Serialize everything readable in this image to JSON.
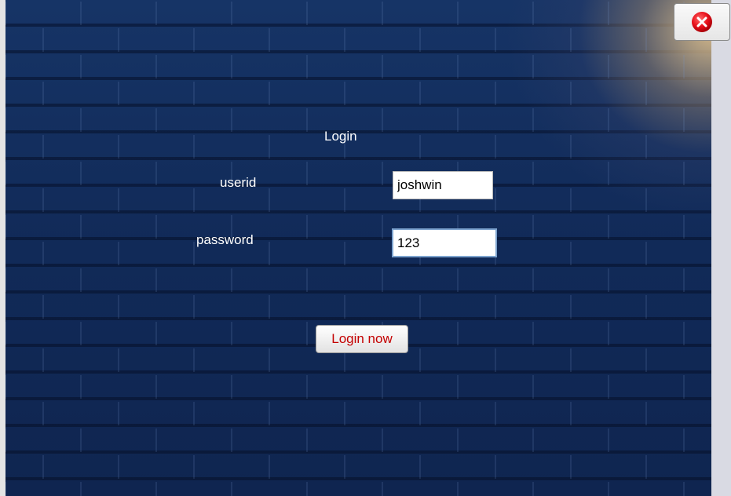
{
  "login_form": {
    "title": "Login",
    "userid_label": "userid",
    "userid_value": "joshwin",
    "password_label": "password",
    "password_value": "123",
    "submit_label": "Login now"
  },
  "window": {
    "close_icon": "close-icon"
  },
  "colors": {
    "background": "#112a58",
    "label_text": "#ffffff",
    "button_text": "#c40000",
    "close_icon": "#e8101a"
  }
}
